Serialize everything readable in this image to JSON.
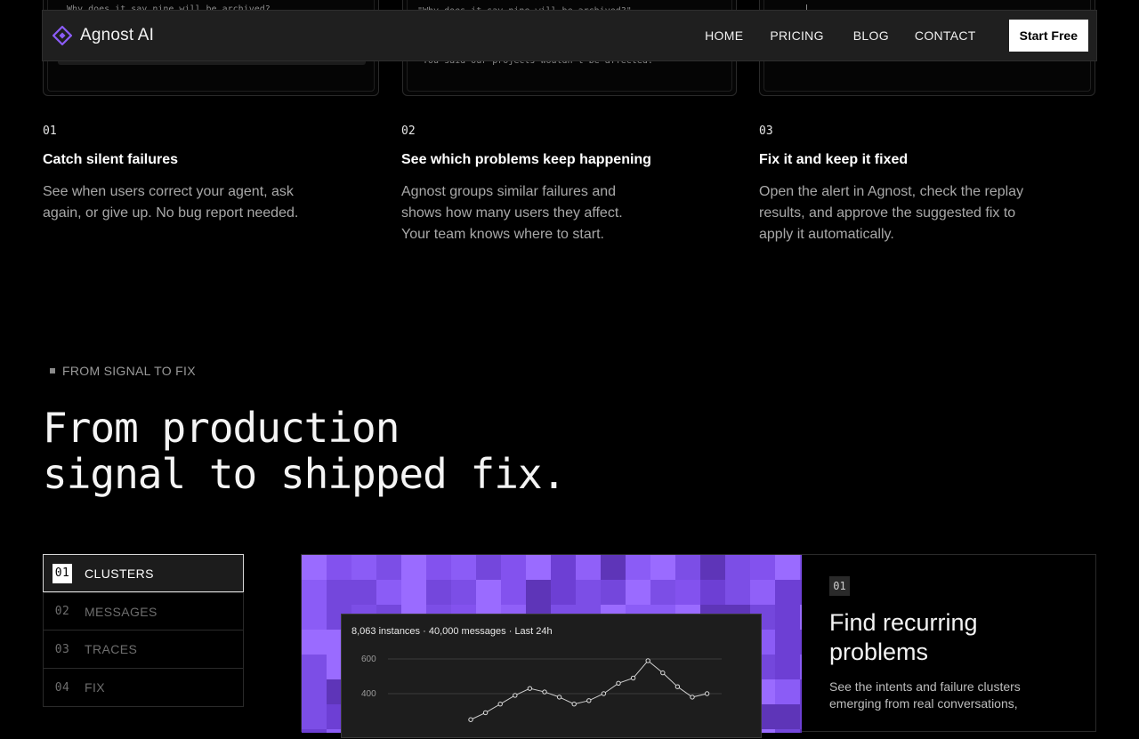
{
  "top_cards": [
    {
      "text": "Why does it say nine will be archived?"
    },
    {
      "text": "\"Why does it say nine will be archived?\"",
      "text2": "You said our projects wouldn't be affected."
    },
    {
      "text": ""
    }
  ],
  "nav": {
    "brand": "Agnost AI",
    "links": [
      "HOME",
      "PRICING",
      "BLOG",
      "CONTACT"
    ],
    "cta": "Start Free",
    "accent": "#8b5cf6"
  },
  "features": [
    {
      "num": "01",
      "title": "Catch silent failures",
      "desc": "See when users correct your agent, ask again, or give up. No bug report needed."
    },
    {
      "num": "02",
      "title": "See which problems keep happening",
      "desc": "Agnost groups similar failures and shows how many users they affect. Your team knows where to start."
    },
    {
      "num": "03",
      "title": "Fix it and keep it fixed",
      "desc": "Open the alert in Agnost, check the replay results, and approve the suggested fix to apply it automatically."
    }
  ],
  "section": {
    "eyebrow": "FROM SIGNAL TO FIX",
    "headline_line1": "From production",
    "headline_line2": "signal to shipped fix."
  },
  "tabs": [
    {
      "num": "01",
      "label": "CLUSTERS",
      "active": true
    },
    {
      "num": "02",
      "label": "MESSAGES",
      "active": false
    },
    {
      "num": "03",
      "label": "TRACES",
      "active": false
    },
    {
      "num": "04",
      "label": "FIX",
      "active": false
    }
  ],
  "showcase": {
    "badge": "01",
    "title": "Find recurring problems",
    "desc": "See the intents and failure clusters emerging from real conversations,",
    "chart_caption": "8,063 instances · 40,000 messages · Last 24h"
  },
  "chart_data": {
    "type": "line",
    "title": "8,063 instances · 40,000 messages · Last 24h",
    "xlabel": "",
    "ylabel": "",
    "ylim": [
      300,
      650
    ],
    "yticks": [
      "600",
      "400"
    ],
    "series": [
      {
        "values": [
          250,
          290,
          340,
          390,
          430,
          410,
          380,
          340,
          360,
          400,
          460,
          490,
          590,
          520,
          440,
          380,
          400
        ]
      }
    ],
    "grid": true
  }
}
